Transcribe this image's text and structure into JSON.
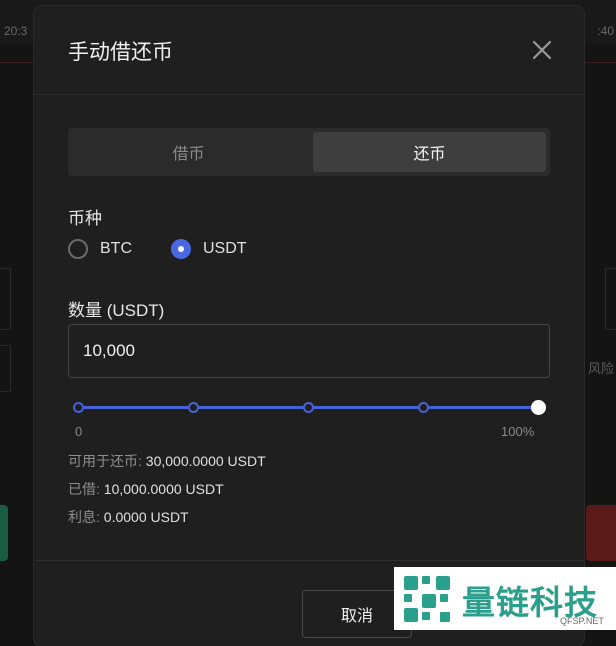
{
  "background": {
    "time_left": "20:3",
    "time_right": ":40",
    "right_text": "风险"
  },
  "modal": {
    "title": "手动借还币",
    "tabs": [
      {
        "label": "借币",
        "active": false
      },
      {
        "label": "还币",
        "active": true
      }
    ],
    "coin_label": "币种",
    "coins": [
      {
        "label": "BTC",
        "selected": false
      },
      {
        "label": "USDT",
        "selected": true
      }
    ],
    "amount_label": "数量 (USDT)",
    "amount_value": "10,000",
    "slider": {
      "min_label": "0",
      "max_label": "100%",
      "value_percent": 100,
      "marks": [
        0,
        25,
        50,
        75,
        100
      ]
    },
    "info": {
      "available_key": "可用于还币:",
      "available_value": "30,000.0000 USDT",
      "borrowed_key": "已借:",
      "borrowed_value": "10,000.0000 USDT",
      "interest_key": "利息:",
      "interest_value": "0.0000 USDT"
    },
    "cancel_label": "取消"
  },
  "watermark": {
    "name": "量链科技",
    "sub": "QFSP.NET"
  },
  "colors": {
    "accent": "#4663d6",
    "modal_bg": "#1f1f1f",
    "watermark": "#2aa08c"
  }
}
